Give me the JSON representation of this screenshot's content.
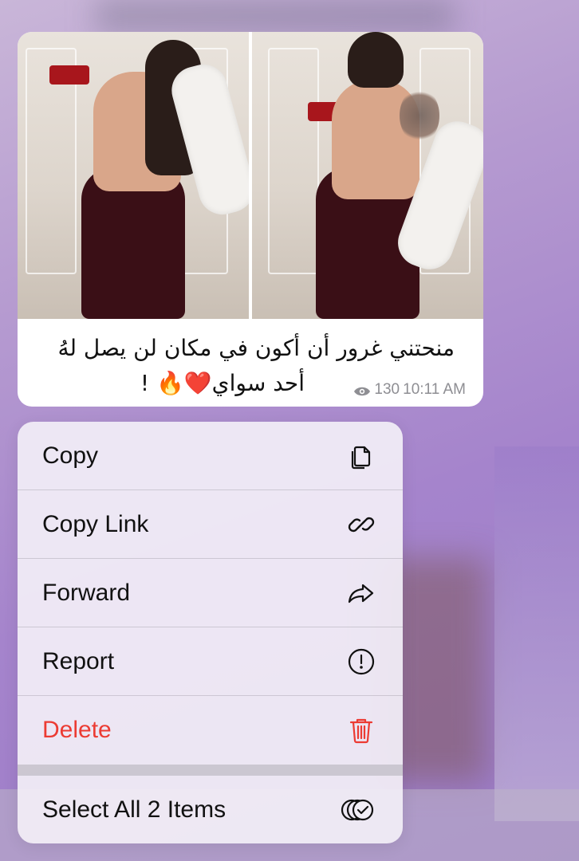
{
  "message": {
    "caption_line1": "منحتني غرور أن أكون في مكان لن يصل لهُ",
    "caption_line2": "أحد سواي❤️🔥 !",
    "views": "130",
    "time": "10:11 AM"
  },
  "menu": {
    "items": [
      {
        "label": "Copy",
        "icon": "copy-icon"
      },
      {
        "label": "Copy Link",
        "icon": "link-icon"
      },
      {
        "label": "Forward",
        "icon": "forward-icon"
      },
      {
        "label": "Report",
        "icon": "report-icon"
      },
      {
        "label": "Delete",
        "icon": "trash-icon",
        "color": "#ec3b33"
      },
      {
        "label": "Select All 2 Items",
        "icon": "select-all-icon"
      }
    ]
  }
}
